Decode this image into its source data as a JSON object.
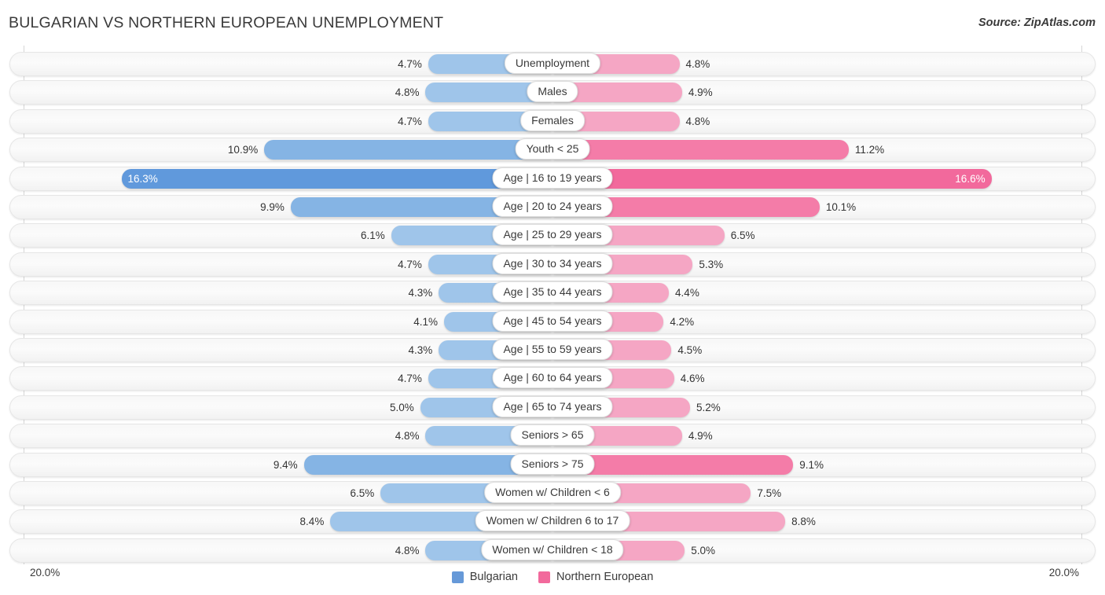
{
  "header": {
    "title": "BULGARIAN VS NORTHERN EUROPEAN UNEMPLOYMENT",
    "source": "Source: ZipAtlas.com"
  },
  "footer": {
    "axis_left": "20.0%",
    "axis_right": "20.0%",
    "legend": [
      {
        "label": "Bulgarian",
        "color": "#6699d8"
      },
      {
        "label": "Northern European",
        "color": "#f2699c"
      }
    ]
  },
  "colors": {
    "blue_light": "#9fc5ea",
    "blue_mid": "#85b4e4",
    "blue_dark": "#6099dc",
    "pink_light": "#f5a6c4",
    "pink_mid": "#f47ca8",
    "pink_dark": "#f2699c",
    "track_border": "#e6e6e6",
    "gridline": "#d6d6d6"
  },
  "chart_data": {
    "type": "bar",
    "orientation": "horizontal-diverging",
    "title": "BULGARIAN VS NORTHERN EUROPEAN UNEMPLOYMENT",
    "xlabel": "",
    "ylabel": "",
    "xlim": [
      20.0,
      20.0
    ],
    "axis_max": 20.0,
    "grid": true,
    "legend_position": "bottom-center",
    "series": [
      {
        "name": "Bulgarian",
        "color": "#6699d8",
        "values": [
          4.7,
          4.8,
          4.7,
          10.9,
          16.3,
          9.9,
          6.1,
          4.7,
          4.3,
          4.1,
          4.3,
          4.7,
          5.0,
          4.8,
          9.4,
          6.5,
          8.4,
          4.8
        ],
        "labels": [
          "4.7%",
          "4.8%",
          "4.7%",
          "10.9%",
          "16.3%",
          "9.9%",
          "6.1%",
          "4.7%",
          "4.3%",
          "4.1%",
          "4.3%",
          "4.7%",
          "5.0%",
          "4.8%",
          "9.4%",
          "6.5%",
          "8.4%",
          "4.8%"
        ]
      },
      {
        "name": "Northern European",
        "color": "#f2699c",
        "values": [
          4.8,
          4.9,
          4.8,
          11.2,
          16.6,
          10.1,
          6.5,
          5.3,
          4.4,
          4.2,
          4.5,
          4.6,
          5.2,
          4.9,
          9.1,
          7.5,
          8.8,
          5.0
        ],
        "labels": [
          "4.8%",
          "4.9%",
          "4.8%",
          "11.2%",
          "16.6%",
          "10.1%",
          "6.5%",
          "5.3%",
          "4.4%",
          "4.2%",
          "4.5%",
          "4.6%",
          "5.2%",
          "4.9%",
          "9.1%",
          "7.5%",
          "8.8%",
          "5.0%"
        ]
      }
    ],
    "categories": [
      "Unemployment",
      "Males",
      "Females",
      "Youth < 25",
      "Age | 16 to 19 years",
      "Age | 20 to 24 years",
      "Age | 25 to 29 years",
      "Age | 30 to 34 years",
      "Age | 35 to 44 years",
      "Age | 45 to 54 years",
      "Age | 55 to 59 years",
      "Age | 60 to 64 years",
      "Age | 65 to 74 years",
      "Seniors > 65",
      "Seniors > 75",
      "Women w/ Children < 6",
      "Women w/ Children 6 to 17",
      "Women w/ Children < 18"
    ]
  },
  "rows": [
    {
      "label": "Unemployment",
      "left_value": 4.7,
      "left_label": "4.7%",
      "right_value": 4.8,
      "right_label": "4.8%"
    },
    {
      "label": "Males",
      "left_value": 4.8,
      "left_label": "4.8%",
      "right_value": 4.9,
      "right_label": "4.9%"
    },
    {
      "label": "Females",
      "left_value": 4.7,
      "left_label": "4.7%",
      "right_value": 4.8,
      "right_label": "4.8%"
    },
    {
      "label": "Youth < 25",
      "left_value": 10.9,
      "left_label": "10.9%",
      "right_value": 11.2,
      "right_label": "11.2%"
    },
    {
      "label": "Age | 16 to 19 years",
      "left_value": 16.3,
      "left_label": "16.3%",
      "right_value": 16.6,
      "right_label": "16.6%"
    },
    {
      "label": "Age | 20 to 24 years",
      "left_value": 9.9,
      "left_label": "9.9%",
      "right_value": 10.1,
      "right_label": "10.1%"
    },
    {
      "label": "Age | 25 to 29 years",
      "left_value": 6.1,
      "left_label": "6.1%",
      "right_value": 6.5,
      "right_label": "6.5%"
    },
    {
      "label": "Age | 30 to 34 years",
      "left_value": 4.7,
      "left_label": "4.7%",
      "right_value": 5.3,
      "right_label": "5.3%"
    },
    {
      "label": "Age | 35 to 44 years",
      "left_value": 4.3,
      "left_label": "4.3%",
      "right_value": 4.4,
      "right_label": "4.4%"
    },
    {
      "label": "Age | 45 to 54 years",
      "left_value": 4.1,
      "left_label": "4.1%",
      "right_value": 4.2,
      "right_label": "4.2%"
    },
    {
      "label": "Age | 55 to 59 years",
      "left_value": 4.3,
      "left_label": "4.3%",
      "right_value": 4.5,
      "right_label": "4.5%"
    },
    {
      "label": "Age | 60 to 64 years",
      "left_value": 4.7,
      "left_label": "4.7%",
      "right_value": 4.6,
      "right_label": "4.6%"
    },
    {
      "label": "Age | 65 to 74 years",
      "left_value": 5.0,
      "left_label": "5.0%",
      "right_value": 5.2,
      "right_label": "5.2%"
    },
    {
      "label": "Seniors > 65",
      "left_value": 4.8,
      "left_label": "4.8%",
      "right_value": 4.9,
      "right_label": "4.9%"
    },
    {
      "label": "Seniors > 75",
      "left_value": 9.4,
      "left_label": "9.4%",
      "right_value": 9.1,
      "right_label": "9.1%"
    },
    {
      "label": "Women w/ Children < 6",
      "left_value": 6.5,
      "left_label": "6.5%",
      "right_value": 7.5,
      "right_label": "7.5%"
    },
    {
      "label": "Women w/ Children 6 to 17",
      "left_value": 8.4,
      "left_label": "8.4%",
      "right_value": 8.8,
      "right_label": "8.8%"
    },
    {
      "label": "Women w/ Children < 18",
      "left_value": 4.8,
      "left_label": "4.8%",
      "right_value": 5.0,
      "right_label": "5.0%"
    }
  ]
}
